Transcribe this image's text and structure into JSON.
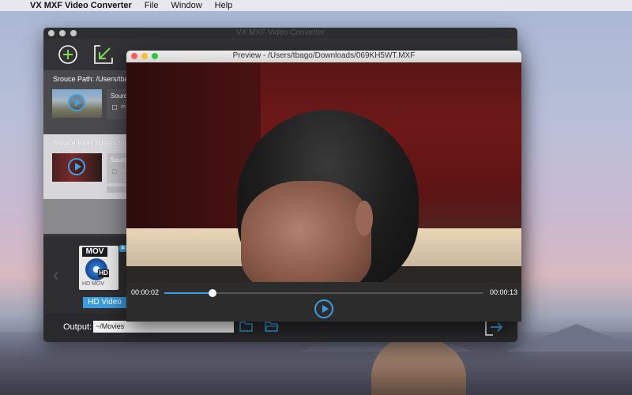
{
  "menubar": {
    "apple": "",
    "app_name": "VX MXF Video Converter",
    "menus": [
      "File",
      "Window",
      "Help"
    ]
  },
  "main_window": {
    "title": "VX MXF Video Converter",
    "items": [
      {
        "source_path_label": "Srouce Path:",
        "source_path_value": "/Users/tbago",
        "source_label": "Sourc",
        "meta": "m"
      },
      {
        "source_path_label": "Srouce Path:",
        "source_path_value": "/Users/tbago",
        "source_label": "Sourc",
        "meta": "m"
      }
    ],
    "format": {
      "badge": "MOV",
      "hd_badge": "HD",
      "subtitle": "HD MOV",
      "button_label": "HD Video"
    },
    "output_label": "Output:",
    "output_value": "~/Movies"
  },
  "preview": {
    "title": "Preview - /Users/tbago/Downloads/069KH5WT.MXF",
    "current_time": "00:00:02",
    "total_time": "00:00:13",
    "progress": 0.15
  },
  "colors": {
    "accent": "#3a9de0",
    "window_bg": "#3a3a3c"
  }
}
